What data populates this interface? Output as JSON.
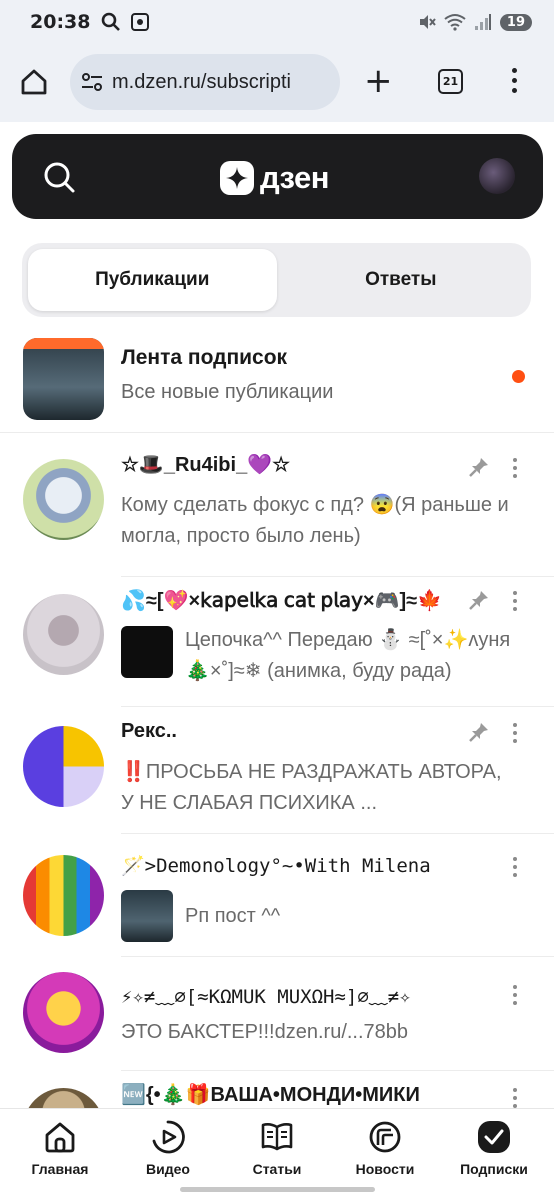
{
  "statusbar": {
    "time": "20:38",
    "battery": "19"
  },
  "browser": {
    "url": "m.dzen.ru/subscripti",
    "tab_count": "21"
  },
  "header": {
    "logo_text": "дзен"
  },
  "segments": {
    "publications": "Публикации",
    "answers": "Ответы"
  },
  "feed": {
    "title": "Лента подписок",
    "subtitle": "Все новые публикации"
  },
  "channels": [
    {
      "name": "☆🎩_Ru4ibi_💜☆",
      "text": "Кому сделать фокус с пд? 😨(Я раньше и могла, просто было лень)",
      "pinned": true
    },
    {
      "name": "💦≈[💖×𝗄𝖺𝗉𝖾𝗅𝗄𝖺 𝖼𝖺𝗍 𝗉𝗅𝖺𝗒×🎮]≈🍁",
      "text": "Цепочка^^ Передаю ⛄ ≈[˚×✨ʌуня🎄×˚]≈❄ (анимка, буду рада)",
      "pinned": true
    },
    {
      "name": "Рекс..",
      "text": "‼️ПРОСЬБА НЕ РАЗДРАЖАТЬ АВТОРА, У НЕ СЛАБАЯ ПСИХИКА ...",
      "pinned": true
    },
    {
      "name": "🪄>Demonology°~•With Milena",
      "text": "Рп пост ^^",
      "pinned": false
    },
    {
      "name": "⚡✧≠﹏⌀[≈KΩMUK MUXΩH≈]⌀﹏≠✧",
      "text": "ЭТО БАКСТЕР!!!dzen.ru/...78bb",
      "pinned": false
    },
    {
      "name": "🆕{•🎄🎁ВАША•МОНДИ•МИКИ",
      "text": "",
      "pinned": false
    }
  ],
  "nav": [
    {
      "label": "Главная"
    },
    {
      "label": "Видео"
    },
    {
      "label": "Статьи"
    },
    {
      "label": "Новости"
    },
    {
      "label": "Подписки"
    }
  ],
  "colors": {
    "accent_dot": "#ff4f12",
    "header_bg": "#1c1c1e"
  }
}
